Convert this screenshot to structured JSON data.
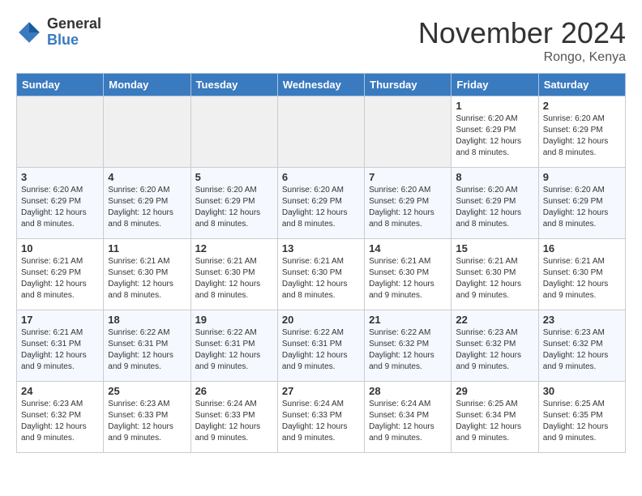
{
  "logo": {
    "general": "General",
    "blue": "Blue"
  },
  "title": "November 2024",
  "location": "Rongo, Kenya",
  "days_of_week": [
    "Sunday",
    "Monday",
    "Tuesday",
    "Wednesday",
    "Thursday",
    "Friday",
    "Saturday"
  ],
  "weeks": [
    [
      {
        "day": "",
        "info": ""
      },
      {
        "day": "",
        "info": ""
      },
      {
        "day": "",
        "info": ""
      },
      {
        "day": "",
        "info": ""
      },
      {
        "day": "",
        "info": ""
      },
      {
        "day": "1",
        "info": "Sunrise: 6:20 AM\nSunset: 6:29 PM\nDaylight: 12 hours and 8 minutes."
      },
      {
        "day": "2",
        "info": "Sunrise: 6:20 AM\nSunset: 6:29 PM\nDaylight: 12 hours and 8 minutes."
      }
    ],
    [
      {
        "day": "3",
        "info": "Sunrise: 6:20 AM\nSunset: 6:29 PM\nDaylight: 12 hours and 8 minutes."
      },
      {
        "day": "4",
        "info": "Sunrise: 6:20 AM\nSunset: 6:29 PM\nDaylight: 12 hours and 8 minutes."
      },
      {
        "day": "5",
        "info": "Sunrise: 6:20 AM\nSunset: 6:29 PM\nDaylight: 12 hours and 8 minutes."
      },
      {
        "day": "6",
        "info": "Sunrise: 6:20 AM\nSunset: 6:29 PM\nDaylight: 12 hours and 8 minutes."
      },
      {
        "day": "7",
        "info": "Sunrise: 6:20 AM\nSunset: 6:29 PM\nDaylight: 12 hours and 8 minutes."
      },
      {
        "day": "8",
        "info": "Sunrise: 6:20 AM\nSunset: 6:29 PM\nDaylight: 12 hours and 8 minutes."
      },
      {
        "day": "9",
        "info": "Sunrise: 6:20 AM\nSunset: 6:29 PM\nDaylight: 12 hours and 8 minutes."
      }
    ],
    [
      {
        "day": "10",
        "info": "Sunrise: 6:21 AM\nSunset: 6:29 PM\nDaylight: 12 hours and 8 minutes."
      },
      {
        "day": "11",
        "info": "Sunrise: 6:21 AM\nSunset: 6:30 PM\nDaylight: 12 hours and 8 minutes."
      },
      {
        "day": "12",
        "info": "Sunrise: 6:21 AM\nSunset: 6:30 PM\nDaylight: 12 hours and 8 minutes."
      },
      {
        "day": "13",
        "info": "Sunrise: 6:21 AM\nSunset: 6:30 PM\nDaylight: 12 hours and 8 minutes."
      },
      {
        "day": "14",
        "info": "Sunrise: 6:21 AM\nSunset: 6:30 PM\nDaylight: 12 hours and 9 minutes."
      },
      {
        "day": "15",
        "info": "Sunrise: 6:21 AM\nSunset: 6:30 PM\nDaylight: 12 hours and 9 minutes."
      },
      {
        "day": "16",
        "info": "Sunrise: 6:21 AM\nSunset: 6:30 PM\nDaylight: 12 hours and 9 minutes."
      }
    ],
    [
      {
        "day": "17",
        "info": "Sunrise: 6:21 AM\nSunset: 6:31 PM\nDaylight: 12 hours and 9 minutes."
      },
      {
        "day": "18",
        "info": "Sunrise: 6:22 AM\nSunset: 6:31 PM\nDaylight: 12 hours and 9 minutes."
      },
      {
        "day": "19",
        "info": "Sunrise: 6:22 AM\nSunset: 6:31 PM\nDaylight: 12 hours and 9 minutes."
      },
      {
        "day": "20",
        "info": "Sunrise: 6:22 AM\nSunset: 6:31 PM\nDaylight: 12 hours and 9 minutes."
      },
      {
        "day": "21",
        "info": "Sunrise: 6:22 AM\nSunset: 6:32 PM\nDaylight: 12 hours and 9 minutes."
      },
      {
        "day": "22",
        "info": "Sunrise: 6:23 AM\nSunset: 6:32 PM\nDaylight: 12 hours and 9 minutes."
      },
      {
        "day": "23",
        "info": "Sunrise: 6:23 AM\nSunset: 6:32 PM\nDaylight: 12 hours and 9 minutes."
      }
    ],
    [
      {
        "day": "24",
        "info": "Sunrise: 6:23 AM\nSunset: 6:32 PM\nDaylight: 12 hours and 9 minutes."
      },
      {
        "day": "25",
        "info": "Sunrise: 6:23 AM\nSunset: 6:33 PM\nDaylight: 12 hours and 9 minutes."
      },
      {
        "day": "26",
        "info": "Sunrise: 6:24 AM\nSunset: 6:33 PM\nDaylight: 12 hours and 9 minutes."
      },
      {
        "day": "27",
        "info": "Sunrise: 6:24 AM\nSunset: 6:33 PM\nDaylight: 12 hours and 9 minutes."
      },
      {
        "day": "28",
        "info": "Sunrise: 6:24 AM\nSunset: 6:34 PM\nDaylight: 12 hours and 9 minutes."
      },
      {
        "day": "29",
        "info": "Sunrise: 6:25 AM\nSunset: 6:34 PM\nDaylight: 12 hours and 9 minutes."
      },
      {
        "day": "30",
        "info": "Sunrise: 6:25 AM\nSunset: 6:35 PM\nDaylight: 12 hours and 9 minutes."
      }
    ]
  ]
}
